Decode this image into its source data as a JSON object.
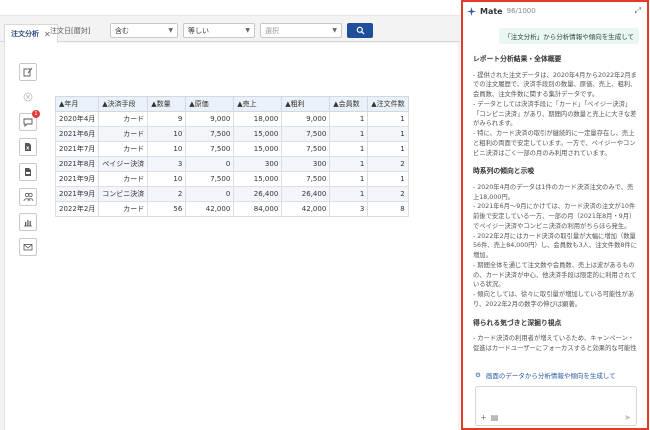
{
  "tab": {
    "label": "注文分析",
    "close": "✕"
  },
  "filters": {
    "field_label": "注文日[暦対]",
    "match_value": "含む",
    "operator_value": "等しい",
    "value_placeholder": "選択"
  },
  "table": {
    "headers": [
      "年月",
      "決済手段",
      "数量",
      "原価",
      "売上",
      "粗利",
      "会員数",
      "注文件数"
    ],
    "rows": [
      [
        "2020年4月",
        "カード",
        "9",
        "9,000",
        "18,000",
        "9,000",
        "1",
        "1"
      ],
      [
        "2021年6月",
        "カード",
        "10",
        "7,500",
        "15,000",
        "7,500",
        "1",
        "1"
      ],
      [
        "2021年7月",
        "カード",
        "10",
        "7,500",
        "15,000",
        "7,500",
        "1",
        "1"
      ],
      [
        "2021年8月",
        "ペイジー決済",
        "3",
        "0",
        "300",
        "300",
        "1",
        "2"
      ],
      [
        "2021年9月",
        "カード",
        "10",
        "7,500",
        "15,000",
        "7,500",
        "1",
        "1"
      ],
      [
        "2021年9月",
        "コンビニ決済",
        "2",
        "0",
        "26,400",
        "26,400",
        "1",
        "2"
      ],
      [
        "2022年2月",
        "カード",
        "56",
        "42,000",
        "84,000",
        "42,000",
        "3",
        "8"
      ]
    ]
  },
  "sidebar": {
    "badge_count": "1"
  },
  "mate": {
    "name": "Mate",
    "counter": "96/1000",
    "user_prompt": "「注文分析」から分析情報や傾向を生成して",
    "sections": [
      {
        "title": "レポート分析結果・全体概要",
        "paragraphs": [
          "- 提供された注文データは、2020年4月から2022年2月までの注文履歴で、決済手段別の数量、原価、売上、粗利、会員数、注文件数に関する集計データです。",
          "- データとしては決済手段に「カード」「ペイジー決済」「コンビニ決済」があり、期間内の数量と売上に大きな差がみられます。",
          "- 特に、カード決済の取引が継続的に一定量存在し、売上と粗利の両面で安定しています。一方で、ペイジーやコンビニ決済はごく一部の月のみ利用されています。"
        ]
      },
      {
        "title": "時系列の傾向と示唆",
        "paragraphs": [
          "- 2020年4月のデータは1件のカード決済注文のみで、売上18,000円。",
          "- 2021年6月〜9月にかけては、カード決済の注文が10件前後で安定している一方、一部の月（2021年8月・9月）でペイジー決済やコンビニ決済の利用がちらほら発生。",
          "- 2022年2月にはカード決済の取引量が大幅に増加（数量56件、売上84,000円）し、会員数も3人、注文件数8件に増加。",
          "- 期間全体を通じて注文数や会員数、売上は波があるものの、カード決済が中心、他決済手段は限定的に利用されている状況。",
          "- 傾向としては、徐々に取引量が増加している可能性があり、2022年2月の数字の伸びは顕著。"
        ]
      },
      {
        "title": "得られる気づきと深掘り視点",
        "paragraphs": [
          "- カード決済の利用者が増えているため、キャンペーン・促進はカードユーザーにフォーカスすると効果的な可能性"
        ]
      }
    ],
    "suggestion": "画面のデータから分析情報や傾向を生成して"
  }
}
